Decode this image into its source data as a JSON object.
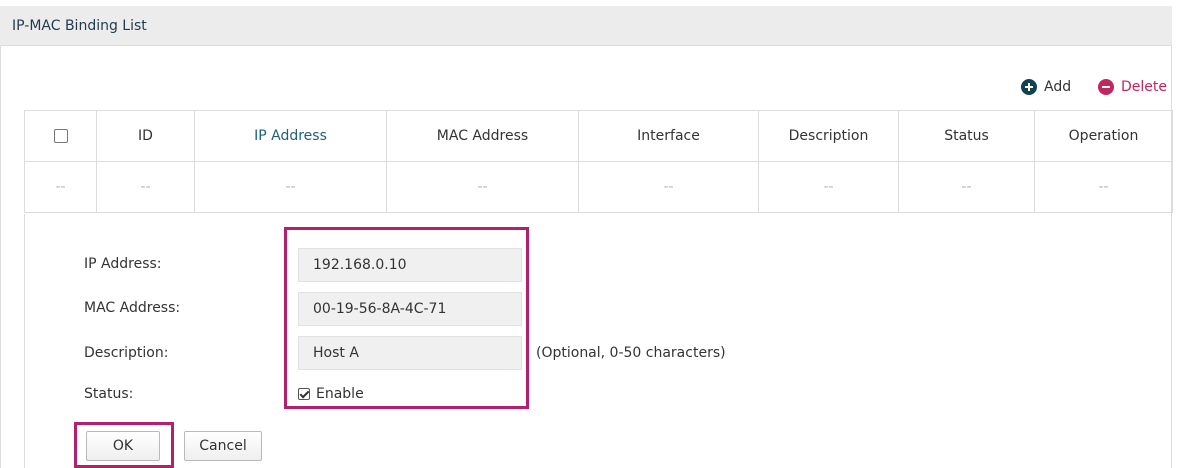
{
  "panel": {
    "title": "IP-MAC Binding List"
  },
  "toolbar": {
    "add_label": "Add",
    "delete_label": "Delete"
  },
  "table": {
    "headers": [
      "ID",
      "IP Address",
      "MAC Address",
      "Interface",
      "Description",
      "Status",
      "Operation"
    ],
    "rows": [
      [
        "--",
        "--",
        "--",
        "--",
        "--",
        "--",
        "--",
        "--"
      ]
    ]
  },
  "form": {
    "ip_label": "IP Address:",
    "ip_value": "192.168.0.10",
    "mac_label": "MAC Address:",
    "mac_value": "00-19-56-8A-4C-71",
    "desc_label": "Description:",
    "desc_value": "Host A",
    "desc_note": "(Optional, 0-50 characters)",
    "status_label": "Status:",
    "enable_label": "Enable",
    "enable_checked": true
  },
  "buttons": {
    "ok_label": "OK",
    "cancel_label": "Cancel"
  },
  "colors": {
    "accent": "#12424f",
    "delete": "#c0265f",
    "highlight": "#b3206b",
    "header_active": "#1f5f7a"
  }
}
